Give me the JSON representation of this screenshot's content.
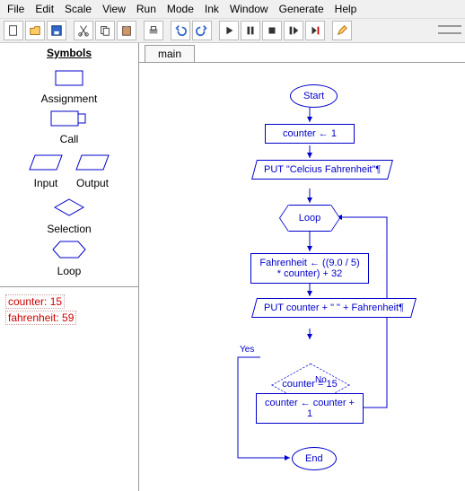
{
  "menu": [
    "File",
    "Edit",
    "Scale",
    "View",
    "Run",
    "Mode",
    "Ink",
    "Window",
    "Generate",
    "Help"
  ],
  "symbols": {
    "title": "Symbols",
    "assignment": "Assignment",
    "call": "Call",
    "input": "Input",
    "output": "Output",
    "selection": "Selection",
    "loop": "Loop"
  },
  "variables": [
    {
      "name": "counter",
      "value": "15"
    },
    {
      "name": "fahrenheit",
      "value": "59"
    }
  ],
  "tab": "main",
  "flow": {
    "start": "Start",
    "init": "counter ← 1",
    "put1": "PUT \"Celcius  Fahrenheit\"¶",
    "loop": "Loop",
    "calc": "Fahrenheit ← ((9.0 / 5) * counter) + 32",
    "put2": "PUT counter + \"  \" + Fahrenheit¶",
    "cond": "counter = 15",
    "yes": "Yes",
    "no": "No",
    "inc": "counter ← counter + 1",
    "end": "End"
  },
  "chart_data": {
    "type": "flowchart",
    "nodes": [
      {
        "id": "start",
        "kind": "terminator",
        "label": "Start"
      },
      {
        "id": "init",
        "kind": "process",
        "label": "counter ← 1"
      },
      {
        "id": "put1",
        "kind": "io",
        "label": "PUT \"Celcius  Fahrenheit\"¶"
      },
      {
        "id": "loop",
        "kind": "loop",
        "label": "Loop"
      },
      {
        "id": "calc",
        "kind": "process",
        "label": "Fahrenheit ← ((9.0 / 5) * counter) + 32"
      },
      {
        "id": "put2",
        "kind": "io",
        "label": "PUT counter + \"  \" + Fahrenheit¶"
      },
      {
        "id": "cond",
        "kind": "decision",
        "label": "counter = 15"
      },
      {
        "id": "inc",
        "kind": "process",
        "label": "counter ← counter + 1"
      },
      {
        "id": "end",
        "kind": "terminator",
        "label": "End"
      }
    ],
    "edges": [
      {
        "from": "start",
        "to": "init"
      },
      {
        "from": "init",
        "to": "put1"
      },
      {
        "from": "put1",
        "to": "loop"
      },
      {
        "from": "loop",
        "to": "calc"
      },
      {
        "from": "calc",
        "to": "put2"
      },
      {
        "from": "put2",
        "to": "cond"
      },
      {
        "from": "cond",
        "to": "inc",
        "label": "No"
      },
      {
        "from": "cond",
        "to": "end",
        "label": "Yes",
        "via": "left-down"
      },
      {
        "from": "inc",
        "to": "loop",
        "via": "right-up"
      }
    ]
  }
}
